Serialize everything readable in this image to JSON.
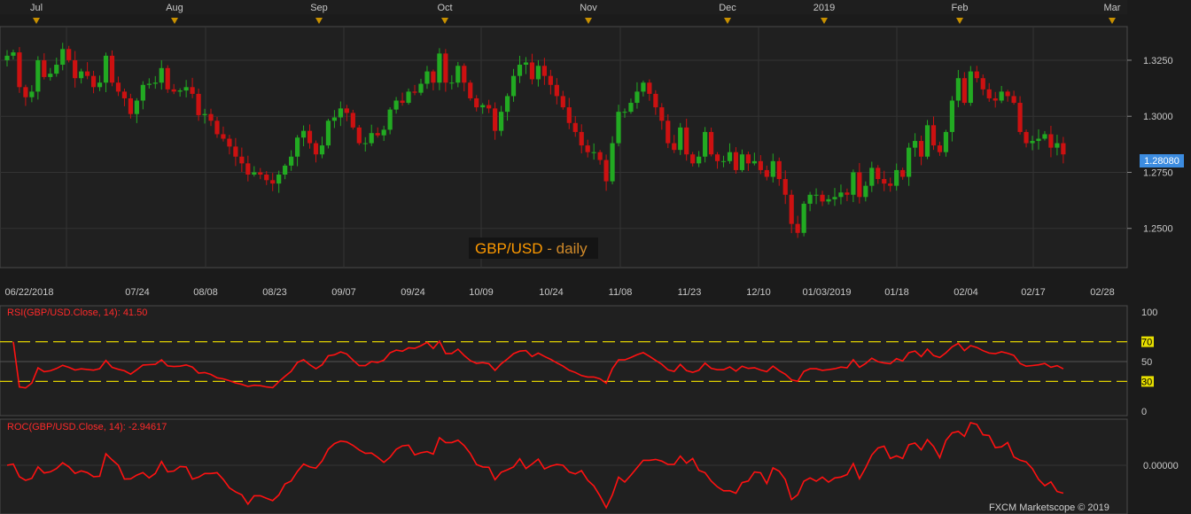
{
  "chart_data": [
    {
      "panel": "price",
      "type": "candlestick",
      "symbol": "GBP/USD",
      "title_symbol": "GBP/USD",
      "title_period": "daily",
      "last_price": "1.28080",
      "ylim": [
        1.2325,
        1.34
      ],
      "yticks": [
        "1.3250",
        "1.3000",
        "1.2750",
        "1.2500"
      ],
      "month_labels": [
        "Jul",
        "Aug",
        "Sep",
        "Oct",
        "Nov",
        "Dec",
        "2019",
        "Feb",
        "Mar"
      ],
      "date_labels": [
        "06/22/2018",
        "07/24",
        "08/08",
        "08/23",
        "09/07",
        "09/24",
        "10/09",
        "10/24",
        "11/08",
        "11/23",
        "12/10",
        "01/03/2019",
        "01/18",
        "02/04",
        "02/17",
        "02/28"
      ],
      "closes": [
        1.327,
        1.3285,
        1.313,
        1.3085,
        1.311,
        1.325,
        1.3175,
        1.319,
        1.323,
        1.33,
        1.325,
        1.317,
        1.32,
        1.318,
        1.313,
        1.315,
        1.327,
        1.315,
        1.311,
        1.308,
        1.301,
        1.307,
        1.314,
        1.3145,
        1.315,
        1.3215,
        1.312,
        1.311,
        1.3115,
        1.313,
        1.31,
        1.3005,
        1.301,
        1.298,
        1.292,
        1.29,
        1.2865,
        1.282,
        1.279,
        1.274,
        1.275,
        1.274,
        1.2715,
        1.27,
        1.274,
        1.278,
        1.282,
        1.2905,
        1.2935,
        1.288,
        1.283,
        1.287,
        1.298,
        1.2995,
        1.3035,
        1.3015,
        1.295,
        1.288,
        1.288,
        1.2925,
        1.2915,
        1.294,
        1.303,
        1.307,
        1.306,
        1.311,
        1.3105,
        1.3145,
        1.32,
        1.315,
        1.328,
        1.315,
        1.315,
        1.3225,
        1.315,
        1.308,
        1.304,
        1.305,
        1.3035,
        1.2935,
        1.302,
        1.309,
        1.318,
        1.323,
        1.324,
        1.3165,
        1.3225,
        1.318,
        1.314,
        1.309,
        1.304,
        1.297,
        1.293,
        1.287,
        1.284,
        1.284,
        1.2805,
        1.271,
        1.288,
        1.302,
        1.302,
        1.306,
        1.311,
        1.315,
        1.31,
        1.304,
        1.298,
        1.288,
        1.285,
        1.295,
        1.283,
        1.279,
        1.282,
        1.293,
        1.283,
        1.28,
        1.28,
        1.284,
        1.276,
        1.283,
        1.279,
        1.28,
        1.276,
        1.273,
        1.28,
        1.272,
        1.265,
        1.252,
        1.248,
        1.261,
        1.265,
        1.265,
        1.262,
        1.263,
        1.264,
        1.266,
        1.265,
        1.275,
        1.264,
        1.269,
        1.277,
        1.272,
        1.27,
        1.269,
        1.276,
        1.273,
        1.286,
        1.289,
        1.282,
        1.296,
        1.287,
        1.284,
        1.293,
        1.307,
        1.317,
        1.306,
        1.32,
        1.317,
        1.312,
        1.308,
        1.307,
        1.311,
        1.309,
        1.306,
        1.293,
        1.288,
        1.289,
        1.29,
        1.292,
        1.286,
        1.288,
        1.283
      ]
    },
    {
      "panel": "rsi",
      "type": "line",
      "label": "RSI(GBP/USD.Close, 14): 41.50",
      "ylim": [
        0,
        100
      ],
      "yticks": [
        "100",
        "70",
        "50",
        "30",
        "0"
      ],
      "levels": [
        70,
        30
      ]
    },
    {
      "panel": "roc",
      "type": "line",
      "label": "ROC(GBP/USD.Close, 14): -2.94617",
      "yticks": [
        "0.00000"
      ]
    }
  ],
  "watermark": "FXCM Marketscope © 2019",
  "colors": {
    "background": "#1b1b1b",
    "panel": "#202020",
    "grid": "#333333",
    "text": "#c8c8c8",
    "up_candle": "#22aa22",
    "down_candle": "#cc1111",
    "indicator": "#ff1111",
    "level_line": "#e0d000",
    "last_price_bg": "#3c8ce0",
    "title_symbol": "#ff9a00",
    "title_period": "#d08a2a",
    "month_marker": "#c89000"
  }
}
